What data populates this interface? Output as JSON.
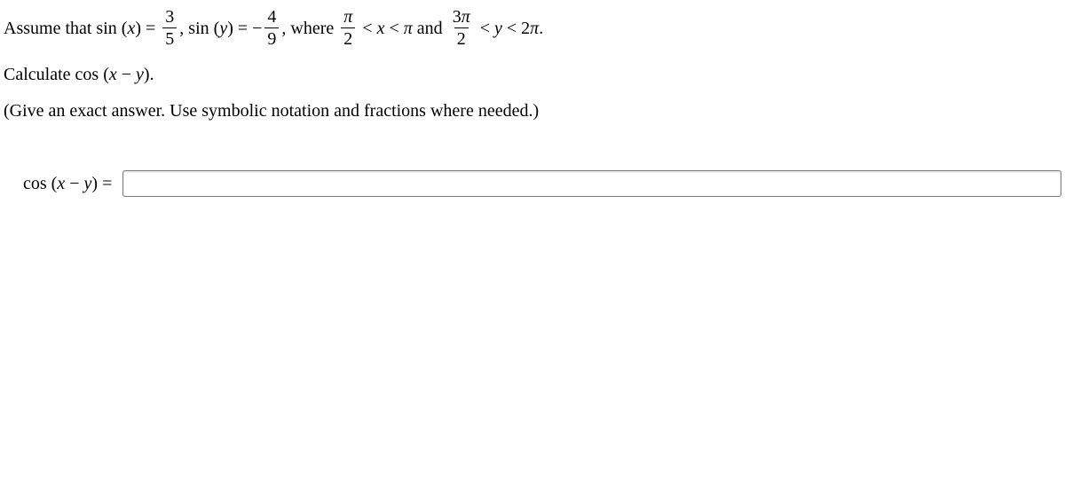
{
  "problem": {
    "intro1": "Assume that sin",
    "openx": " (",
    "varx": "x",
    "closex_eq": ") = ",
    "frac1_num": "3",
    "frac1_den": "5",
    "comma_sin": ", sin",
    "openy": " (",
    "vary": "y",
    "closey_eq": ") = −",
    "frac2_num": "4",
    "frac2_den": "9",
    "comma_where": ", where ",
    "frac3_num": "π",
    "frac3_den": "2",
    "lt1": " < ",
    "varx2": "x",
    "ltpi_and": " < ",
    "pi_text": "π",
    "and_text": " and ",
    "frac4_num": "3π",
    "frac4_den": "2",
    "lt2": " < ",
    "vary2": "y",
    "lt2pi": " < 2",
    "pi2": "π",
    "period": "."
  },
  "line2": {
    "calc": "Calculate cos",
    "open": " (",
    "x": "x",
    "minus": " − ",
    "y": "y",
    "close": ")."
  },
  "line3": "(Give an exact answer. Use symbolic notation and fractions where needed.)",
  "answer": {
    "cos": "cos",
    "open": " (",
    "x": "x",
    "minus": " − ",
    "y": "y",
    "close_eq": ") = ",
    "value": ""
  }
}
